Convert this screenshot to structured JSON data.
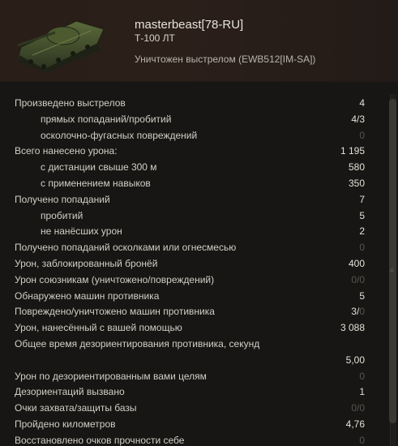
{
  "header": {
    "player_name": "masterbeast[78-RU]",
    "tank_name": "Т-100 ЛТ",
    "kill_status": "Уничтожен выстрелом (EWB512[IM-SA])",
    "tank_icon": "light-tank-image"
  },
  "stats": [
    {
      "label": "Произведено выстрелов",
      "value": "4",
      "sub": false,
      "dim": false
    },
    {
      "label": "прямых попаданий/пробитий",
      "value": "4/3",
      "sub": true,
      "dim": false
    },
    {
      "label": "осколочно-фугасных повреждений",
      "value": "0",
      "sub": true,
      "dim": true
    },
    {
      "label": "Всего нанесено урона:",
      "value": "1 195",
      "sub": false,
      "dim": false
    },
    {
      "label": "с дистанции свыше 300 м",
      "value": "580",
      "sub": true,
      "dim": false
    },
    {
      "label": "с применением навыков",
      "value": "350",
      "sub": true,
      "dim": false
    },
    {
      "label": "Получено попаданий",
      "value": "7",
      "sub": false,
      "dim": false
    },
    {
      "label": "пробитий",
      "value": "5",
      "sub": true,
      "dim": false
    },
    {
      "label": "не нанёсших урон",
      "value": "2",
      "sub": true,
      "dim": false
    },
    {
      "label": "Получено попаданий осколками или огнесмесью",
      "value": "0",
      "sub": false,
      "dim": true
    },
    {
      "label": "Урон, заблокированный бронёй",
      "value": "400",
      "sub": false,
      "dim": false
    },
    {
      "label": "Урон союзникам (уничтожено/повреждений)",
      "value": "0/0",
      "sub": false,
      "dim": true
    },
    {
      "label": "Обнаружено машин противника",
      "value": "5",
      "sub": false,
      "dim": false
    },
    {
      "label": "Повреждено/уничтожено машин противника",
      "value_main": "3/",
      "value_dim": "0",
      "sub": false,
      "dim": false
    },
    {
      "label": "Урон, нанесённый с вашей помощью",
      "value": "3 088",
      "sub": false,
      "dim": false
    },
    {
      "label": "Общее время дезориентирования противника, секунд",
      "value": "5,00",
      "sub": false,
      "dim": false,
      "tall": true
    },
    {
      "label": "Урон по дезориентированным вами целям",
      "value": "0",
      "sub": false,
      "dim": true
    },
    {
      "label": "Дезориентаций вызвано",
      "value": "1",
      "sub": false,
      "dim": false
    },
    {
      "label": "Очки захвата/защиты базы",
      "value": "0/0",
      "sub": false,
      "dim": true
    },
    {
      "label": "Пройдено километров",
      "value": "4,76",
      "sub": false,
      "dim": false
    },
    {
      "label": "Восстановлено очков прочности себе",
      "value": "0",
      "sub": false,
      "dim": true
    }
  ]
}
